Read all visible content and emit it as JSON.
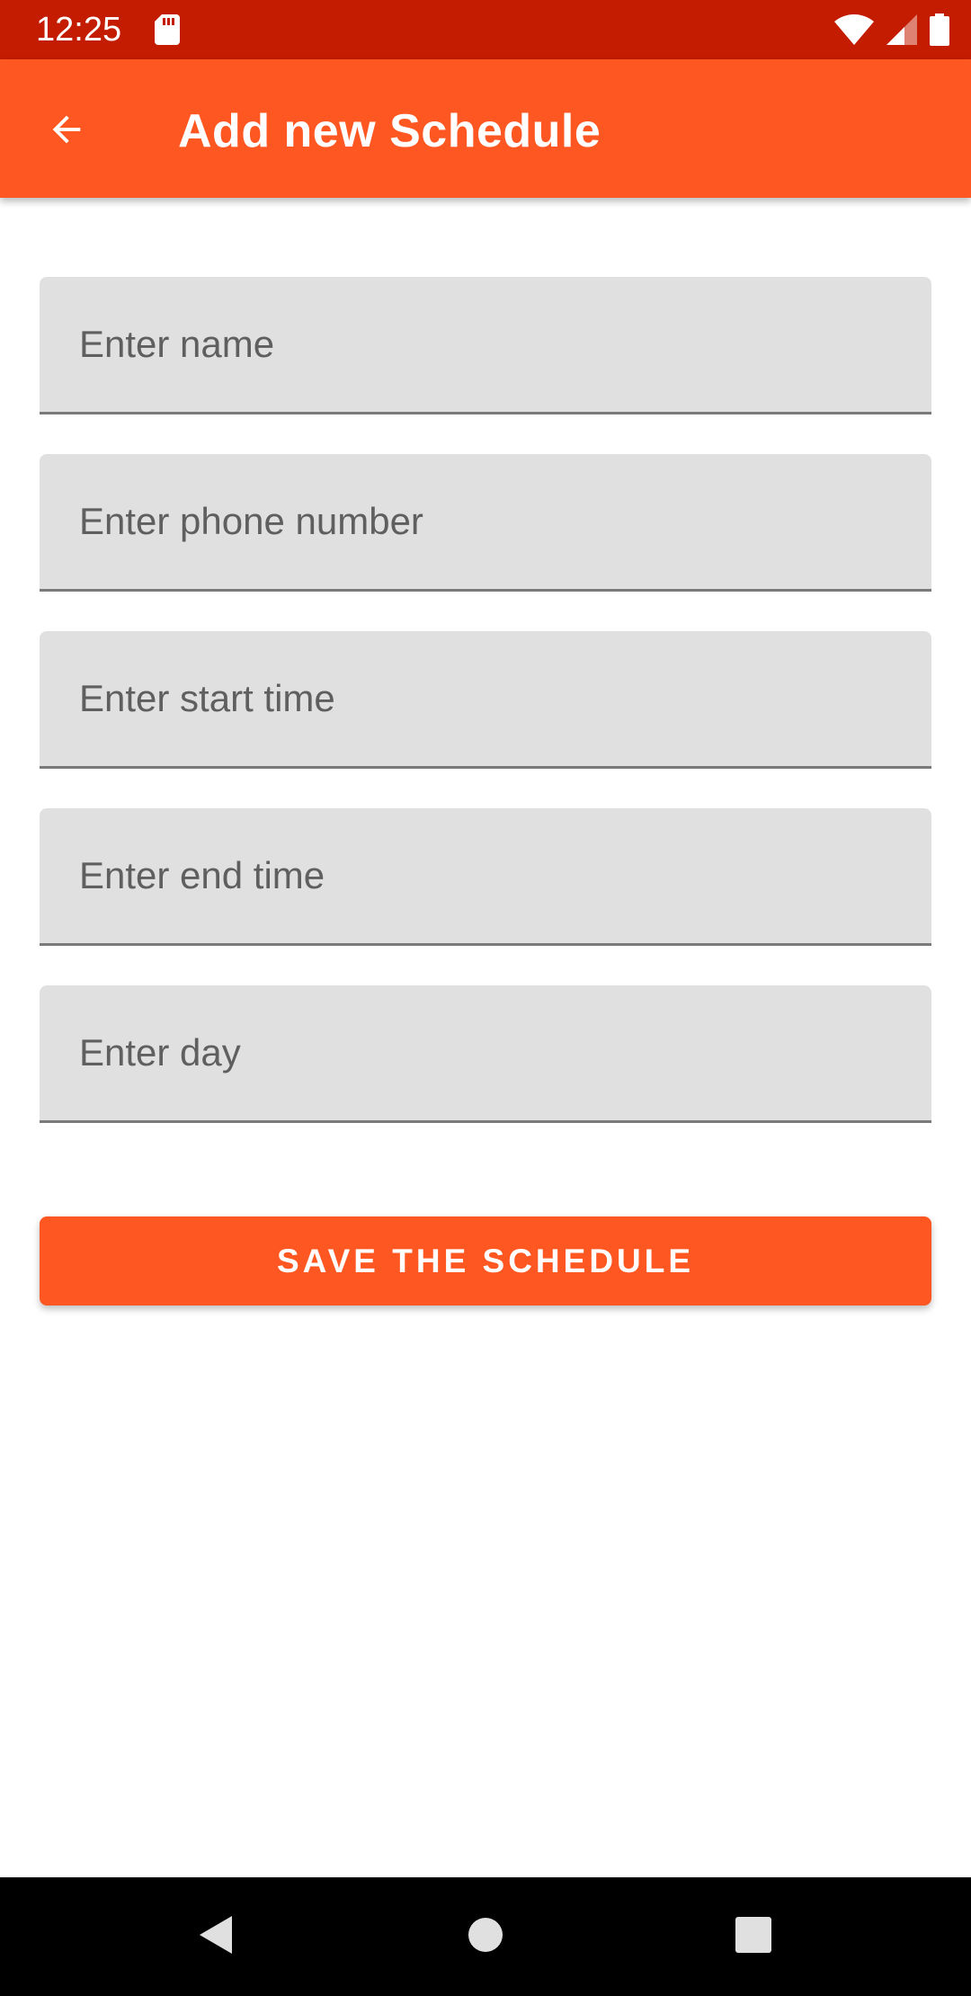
{
  "status_bar": {
    "time": "12:25",
    "icons": [
      "sd-card-icon",
      "wifi-icon",
      "cell-signal-icon",
      "battery-icon"
    ]
  },
  "app_bar": {
    "back_icon": "arrow-back-icon",
    "title": "Add new Schedule"
  },
  "form": {
    "fields": [
      {
        "placeholder": "Enter name",
        "value": ""
      },
      {
        "placeholder": "Enter phone number",
        "value": ""
      },
      {
        "placeholder": "Enter start time",
        "value": ""
      },
      {
        "placeholder": "Enter end time",
        "value": ""
      },
      {
        "placeholder": "Enter day",
        "value": ""
      }
    ],
    "save_label": "SAVE THE SCHEDULE"
  },
  "nav_bar": {
    "icons": [
      "nav-back-icon",
      "nav-home-icon",
      "nav-recents-icon"
    ]
  },
  "colors": {
    "status_bar": "#c41c00",
    "accent": "#ff5722",
    "field_background": "#e0e0e0",
    "nav_bar": "#000000"
  }
}
